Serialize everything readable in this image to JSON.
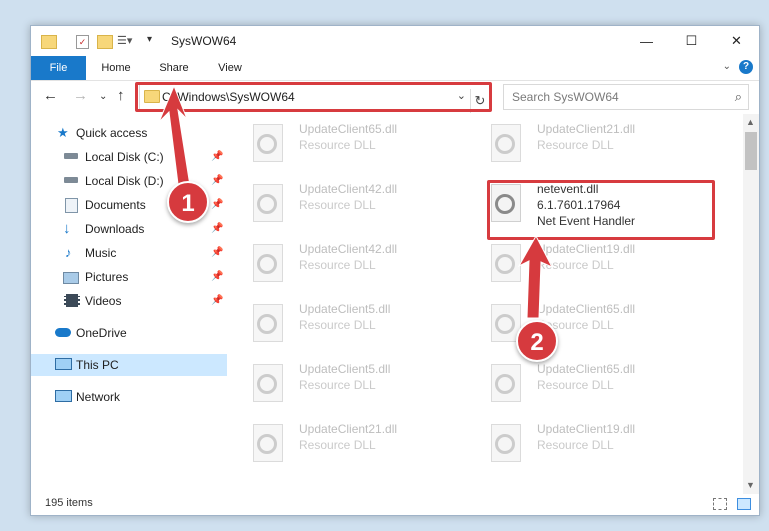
{
  "window": {
    "title": "SysWOW64",
    "controls": {
      "minimize": "—",
      "maximize": "☐",
      "close": "✕"
    }
  },
  "ribbon": {
    "tabs": [
      "File",
      "Home",
      "Share",
      "View"
    ],
    "help": "?"
  },
  "navigation": {
    "address": "C:\\Windows\\SysWOW64",
    "search_placeholder": "Search SysWOW64"
  },
  "sidebar": {
    "items": [
      {
        "label": "Quick access",
        "icon": "star-icon"
      },
      {
        "label": "Local Disk (C:)",
        "icon": "drive-icon",
        "pinned": true
      },
      {
        "label": "Local Disk (D:)",
        "icon": "drive-icon",
        "pinned": true
      },
      {
        "label": "Documents",
        "icon": "documents-icon",
        "pinned": true
      },
      {
        "label": "Downloads",
        "icon": "download-icon",
        "pinned": true
      },
      {
        "label": "Music",
        "icon": "music-icon",
        "pinned": true
      },
      {
        "label": "Pictures",
        "icon": "pictures-icon",
        "pinned": true
      },
      {
        "label": "Videos",
        "icon": "videos-icon",
        "pinned": true
      },
      {
        "label": "OneDrive",
        "icon": "cloud-icon"
      },
      {
        "label": "This PC",
        "icon": "computer-icon",
        "selected": true
      },
      {
        "label": "Network",
        "icon": "network-icon"
      }
    ]
  },
  "files": [
    {
      "name": "UpdateClient65.dll",
      "desc": "Resource DLL"
    },
    {
      "name": "UpdateClient21.dll",
      "desc": "Resource DLL"
    },
    {
      "name": "UpdateClient42.dll",
      "desc": "Resource DLL"
    },
    {
      "name": "netevent.dll",
      "version": "6.1.7601.17964",
      "desc": "Net Event Handler",
      "highlighted": true
    },
    {
      "name": "UpdateClient42.dll",
      "desc": "Resource DLL"
    },
    {
      "name": "UpdateClient19.dll",
      "desc": "Resource DLL"
    },
    {
      "name": "UpdateClient5.dll",
      "desc": "Resource DLL"
    },
    {
      "name": "UpdateClient65.dll",
      "desc": "Resource DLL"
    },
    {
      "name": "UpdateClient5.dll",
      "desc": "Resource DLL"
    },
    {
      "name": "UpdateClient65.dll",
      "desc": "Resource DLL"
    },
    {
      "name": "UpdateClient21.dll",
      "desc": "Resource DLL"
    },
    {
      "name": "UpdateClient19.dll",
      "desc": "Resource DLL"
    }
  ],
  "status": {
    "count": "195 items"
  },
  "annotations": [
    {
      "label": "1",
      "color": "#d63a3e"
    },
    {
      "label": "2",
      "color": "#d63a3e"
    }
  ]
}
